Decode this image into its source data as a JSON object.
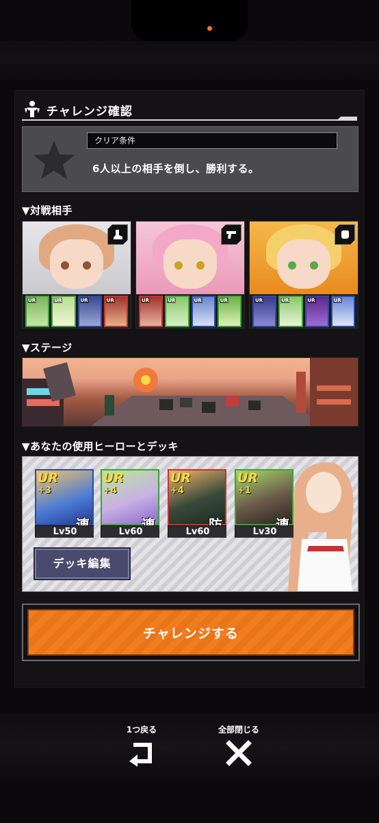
{
  "header": {
    "title": "チャレンジ確認"
  },
  "clear": {
    "label": "クリア条件",
    "text": "6人以上の相手を倒し、勝利する。"
  },
  "sections": {
    "opponents": "▼対戦相手",
    "stage": "▼ステージ",
    "deck": "▼あなたの使用ヒーローとデッキ"
  },
  "opponents": [
    {
      "role_icon": "boot-icon",
      "hair": "#e0a982",
      "eye": "#8a5634",
      "cards": [
        {
          "tag": "UR",
          "color": "#3aa33a"
        },
        {
          "tag": "UR",
          "color": "#3aa33a"
        },
        {
          "tag": "UR",
          "color": "#2a4aa8"
        },
        {
          "tag": "UR",
          "color": "#c83232"
        }
      ]
    },
    {
      "role_icon": "gun-icon",
      "hair": "#f3a8c8",
      "eye": "#c8a41e",
      "cards": [
        {
          "tag": "UR",
          "color": "#c83232"
        },
        {
          "tag": "UR",
          "color": "#3aa33a"
        },
        {
          "tag": "UR",
          "color": "#2a4aa8"
        },
        {
          "tag": "UR",
          "color": "#3aa33a"
        }
      ]
    },
    {
      "role_icon": "fist-icon",
      "hair": "#f4cf6a",
      "eye": "#5aa84a",
      "cards": [
        {
          "tag": "UR",
          "color": "#2a4aa8"
        },
        {
          "tag": "UR",
          "color": "#3aa33a"
        },
        {
          "tag": "UR",
          "color": "#2a4aa8"
        },
        {
          "tag": "UR",
          "color": "#2a4aa8"
        }
      ]
    }
  ],
  "heroes": [
    {
      "rarity": "UR",
      "plus": "+3",
      "role": "連",
      "level": "Lv50",
      "frame": "#2a4aa8"
    },
    {
      "rarity": "UR",
      "plus": "+4",
      "role": "連",
      "level": "Lv60",
      "frame": "#3aa33a"
    },
    {
      "rarity": "UR",
      "plus": "+4",
      "role": "防",
      "level": "Lv60",
      "frame": "#c83232"
    },
    {
      "rarity": "UR",
      "plus": "+1",
      "role": "連",
      "level": "Lv30",
      "frame": "#3aa33a"
    }
  ],
  "deck_edit_label": "デッキ編集",
  "challenge_label": "チャレンジする",
  "nav": {
    "back_label": "1つ戻る",
    "close_label": "全部閉じる"
  },
  "colors": {
    "accent": "#f07d1e",
    "panel": "#141215"
  }
}
